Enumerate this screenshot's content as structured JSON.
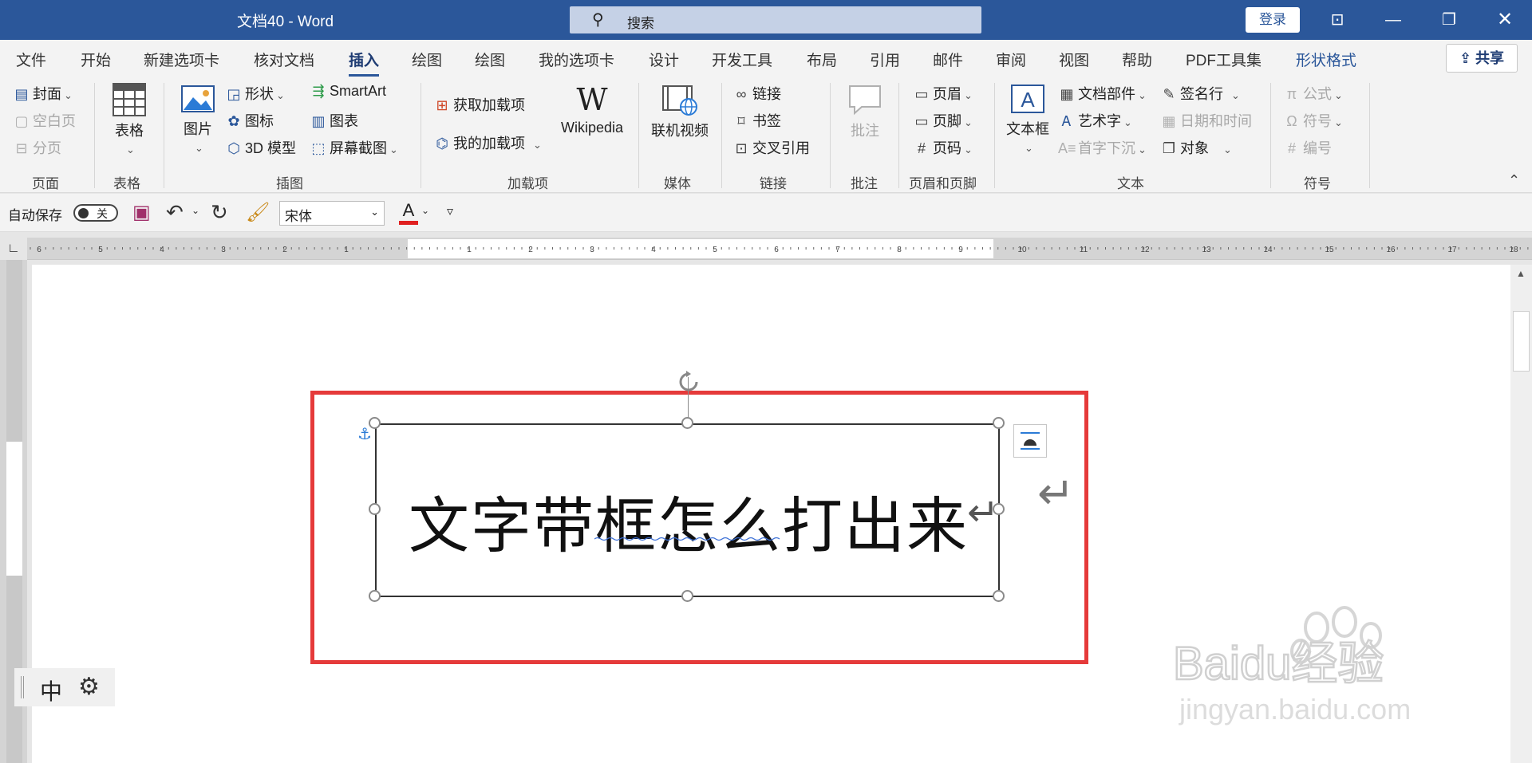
{
  "titlebar": {
    "doc_title": "文档40  -  Word",
    "search_placeholder": "搜索",
    "login_label": "登录"
  },
  "tabs": [
    "文件",
    "开始",
    "新建选项卡",
    "核对文档",
    "插入",
    "绘图",
    "绘图",
    "我的选项卡",
    "设计",
    "开发工具",
    "布局",
    "引用",
    "邮件",
    "审阅",
    "视图",
    "帮助",
    "PDF工具集",
    "形状格式"
  ],
  "active_tab": "插入",
  "share_label": "共享",
  "ribbon": {
    "pages": {
      "cover": "封面",
      "blank": "空白页",
      "break": "分页",
      "label": "页面"
    },
    "tables": {
      "table": "表格",
      "label": "表格"
    },
    "illustrations": {
      "picture": "图片",
      "shapes": "形状",
      "icons": "图标",
      "model3d": "3D 模型",
      "smartart": "SmartArt",
      "chart": "图表",
      "screenshot": "屏幕截图",
      "label": "插图"
    },
    "addins": {
      "get": "获取加载项",
      "mine": "我的加载项",
      "wikipedia": "Wikipedia",
      "label": "加载项"
    },
    "media": {
      "video": "联机视频",
      "label": "媒体"
    },
    "links": {
      "link": "链接",
      "bookmark": "书签",
      "crossref": "交叉引用",
      "label": "链接"
    },
    "comments": {
      "comment": "批注",
      "label": "批注"
    },
    "header_footer": {
      "header": "页眉",
      "footer": "页脚",
      "page_number": "页码",
      "label": "页眉和页脚"
    },
    "text": {
      "textbox": "文本框",
      "quickparts": "文档部件",
      "wordart": "艺术字",
      "dropcap": "首字下沉",
      "signature": "签名行",
      "datetime": "日期和时间",
      "object": "对象",
      "label": "文本"
    },
    "symbols": {
      "equation": "公式",
      "symbol": "符号",
      "number": "编号",
      "label": "符号"
    }
  },
  "qat": {
    "autosave_label": "自动保存",
    "autosave_state": "关",
    "font_name": "宋体",
    "font_color_letter": "A"
  },
  "document": {
    "textbox_text": "文字带框怎么打出来"
  },
  "ime": {
    "mode": "中"
  },
  "watermark": {
    "line1": "Baidu经验",
    "line2": "jingyan.baidu.com"
  },
  "colors": {
    "brand": "#2b579a",
    "highlight_border": "#e53a3a",
    "font_color_bar": "#e02020"
  }
}
